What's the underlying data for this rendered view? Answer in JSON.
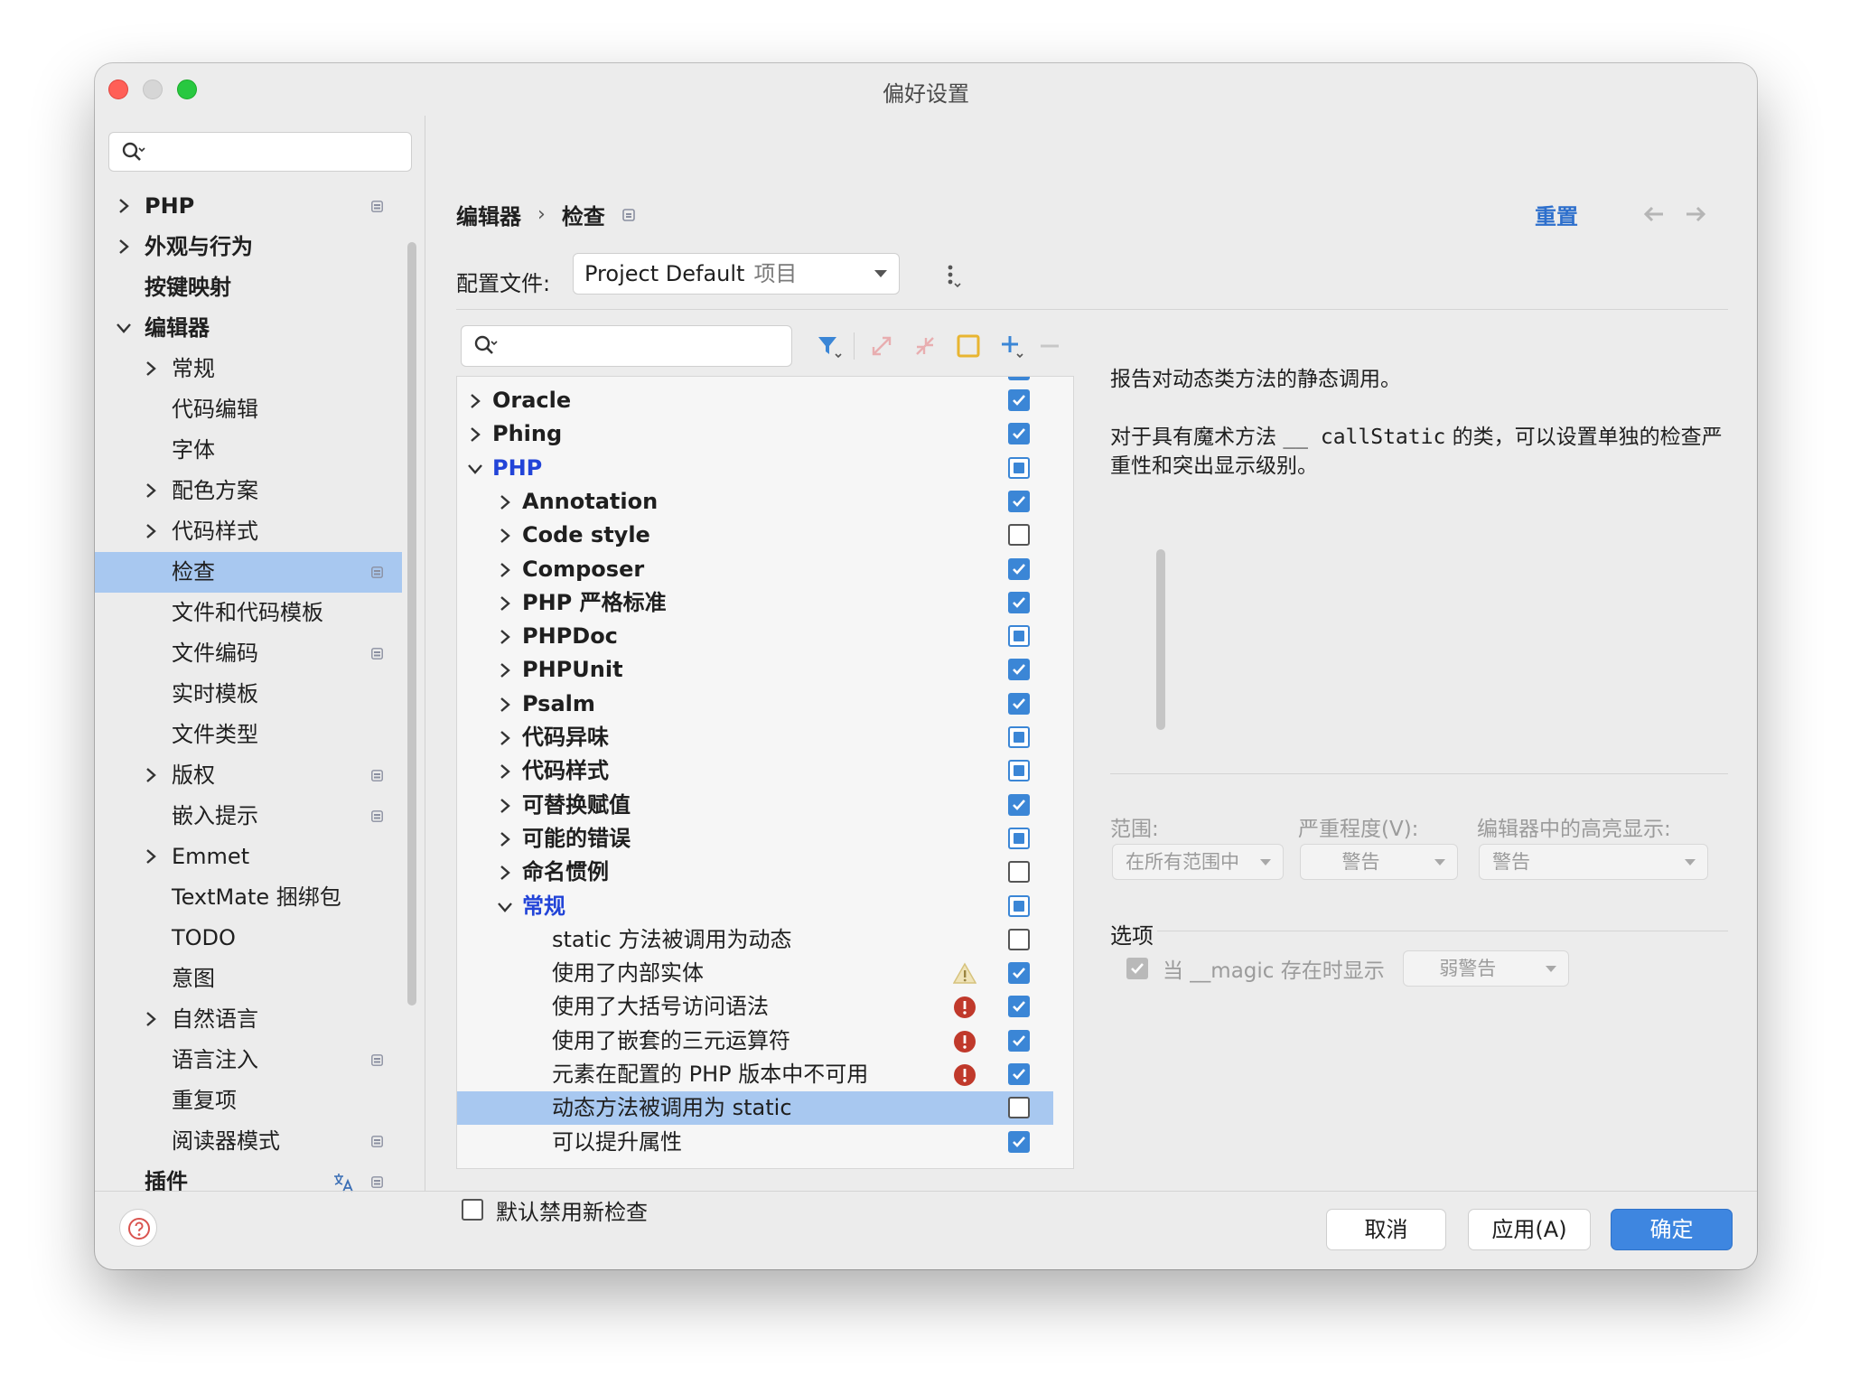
{
  "window": {
    "title": "偏好设置"
  },
  "sidebar": {
    "search_placeholder": "",
    "items": [
      {
        "label": "PHP",
        "chevron": true,
        "indent": 0,
        "bold": true,
        "badge": true
      },
      {
        "label": "外观与行为",
        "chevron": true,
        "indent": 0,
        "bold": true
      },
      {
        "label": "按键映射",
        "chevron": false,
        "indent": 0,
        "bold": true
      },
      {
        "label": "编辑器",
        "chevron": "down",
        "indent": 0,
        "bold": true
      },
      {
        "label": "常规",
        "chevron": true,
        "indent": 1
      },
      {
        "label": "代码编辑",
        "chevron": false,
        "indent": 1
      },
      {
        "label": "字体",
        "chevron": false,
        "indent": 1
      },
      {
        "label": "配色方案",
        "chevron": true,
        "indent": 1
      },
      {
        "label": "代码样式",
        "chevron": true,
        "indent": 1
      },
      {
        "label": "检查",
        "chevron": false,
        "indent": 1,
        "badge": true,
        "selected": true
      },
      {
        "label": "文件和代码模板",
        "chevron": false,
        "indent": 1
      },
      {
        "label": "文件编码",
        "chevron": false,
        "indent": 1,
        "badge": true
      },
      {
        "label": "实时模板",
        "chevron": false,
        "indent": 1
      },
      {
        "label": "文件类型",
        "chevron": false,
        "indent": 1
      },
      {
        "label": "版权",
        "chevron": true,
        "indent": 1,
        "badge": true
      },
      {
        "label": "嵌入提示",
        "chevron": false,
        "indent": 1,
        "badge": true
      },
      {
        "label": "Emmet",
        "chevron": true,
        "indent": 1
      },
      {
        "label": "TextMate 捆绑包",
        "chevron": false,
        "indent": 1
      },
      {
        "label": "TODO",
        "chevron": false,
        "indent": 1
      },
      {
        "label": "意图",
        "chevron": false,
        "indent": 1
      },
      {
        "label": "自然语言",
        "chevron": true,
        "indent": 1
      },
      {
        "label": "语言注入",
        "chevron": false,
        "indent": 1,
        "badge": true
      },
      {
        "label": "重复项",
        "chevron": false,
        "indent": 1
      },
      {
        "label": "阅读器模式",
        "chevron": false,
        "indent": 1,
        "badge": true
      },
      {
        "label": "插件",
        "chevron": false,
        "indent": 0,
        "bold": true,
        "badge": true,
        "lang_icon": true
      }
    ]
  },
  "header": {
    "breadcrumb": [
      "编辑器",
      "检查"
    ],
    "breadcrumb_sep": "›",
    "reset_label": "重置"
  },
  "profile": {
    "label": "配置文件:",
    "value": "Project Default",
    "scope": "项目"
  },
  "inspection_search": {
    "placeholder": ""
  },
  "toolbar": [
    "filter-icon",
    "expand-all-icon",
    "collapse-all-icon",
    "reset-to-default-icon",
    "add-icon",
    "remove-icon"
  ],
  "tree": {
    "rows": [
      {
        "label": "Oracle",
        "level": 0,
        "chevron": "right",
        "check": "on"
      },
      {
        "label": "Phing",
        "level": 0,
        "chevron": "right",
        "check": "on"
      },
      {
        "label": "PHP",
        "level": 0,
        "chevron": "down",
        "check": "mixed",
        "blue": true
      },
      {
        "label": "Annotation",
        "level": 1,
        "chevron": "right",
        "check": "on"
      },
      {
        "label": "Code style",
        "level": 1,
        "chevron": "right",
        "check": "off"
      },
      {
        "label": "Composer",
        "level": 1,
        "chevron": "right",
        "check": "on"
      },
      {
        "label": "PHP 严格标准",
        "level": 1,
        "chevron": "right",
        "check": "on"
      },
      {
        "label": "PHPDoc",
        "level": 1,
        "chevron": "right",
        "check": "mixed"
      },
      {
        "label": "PHPUnit",
        "level": 1,
        "chevron": "right",
        "check": "on"
      },
      {
        "label": "Psalm",
        "level": 1,
        "chevron": "right",
        "check": "on"
      },
      {
        "label": "代码异味",
        "level": 1,
        "chevron": "right",
        "check": "mixed"
      },
      {
        "label": "代码样式",
        "level": 1,
        "chevron": "right",
        "check": "mixed"
      },
      {
        "label": "可替换赋值",
        "level": 1,
        "chevron": "right",
        "check": "on"
      },
      {
        "label": "可能的错误",
        "level": 1,
        "chevron": "right",
        "check": "mixed"
      },
      {
        "label": "命名惯例",
        "level": 1,
        "chevron": "right",
        "check": "off"
      },
      {
        "label": "常规",
        "level": 1,
        "chevron": "down",
        "check": "mixed",
        "blue": true
      },
      {
        "label": "static 方法被调用为动态",
        "level": 2,
        "check": "off"
      },
      {
        "label": "使用了内部实体",
        "level": 2,
        "check": "on",
        "severity": "warning"
      },
      {
        "label": "使用了大括号访问语法",
        "level": 2,
        "check": "on",
        "severity": "error"
      },
      {
        "label": "使用了嵌套的三元运算符",
        "level": 2,
        "check": "on",
        "severity": "error"
      },
      {
        "label": "元素在配置的 PHP 版本中不可用",
        "level": 2,
        "check": "on",
        "severity": "error"
      },
      {
        "label": "动态方法被调用为 static",
        "level": 2,
        "check": "off",
        "selected": true
      },
      {
        "label": "可以提升属性",
        "level": 2,
        "check": "on"
      }
    ]
  },
  "disable_new": {
    "label": "默认禁用新检查",
    "checked": false
  },
  "description": {
    "line1": "报告对动态类方法的静态调用。",
    "line2_a": "对于具有魔术方法 ",
    "line2_code": "__ callStatic",
    "line2_b": " 的类，可以设置单独的检查严重性和突出显示级别。"
  },
  "settings": {
    "scope_label": "范围:",
    "scope_value": "在所有范围中",
    "severity_label": "严重程度(V):",
    "severity_value": "警告",
    "highlight_label": "编辑器中的高亮显示:",
    "highlight_value": "警告"
  },
  "options": {
    "title": "选项",
    "magic_label": "当 __magic 存在时显示",
    "magic_checked": true,
    "magic_level": "弱警告"
  },
  "footer": {
    "cancel_label": "取消",
    "apply_label": "应用(A)",
    "ok_label": "确定"
  },
  "colors": {
    "accent": "#3e86e0",
    "selection": "#a8c8f0",
    "link": "#2d6fcc",
    "tree_group_blue": "#2244d8",
    "error": "#c0392b",
    "warning": "#d9c58a"
  }
}
